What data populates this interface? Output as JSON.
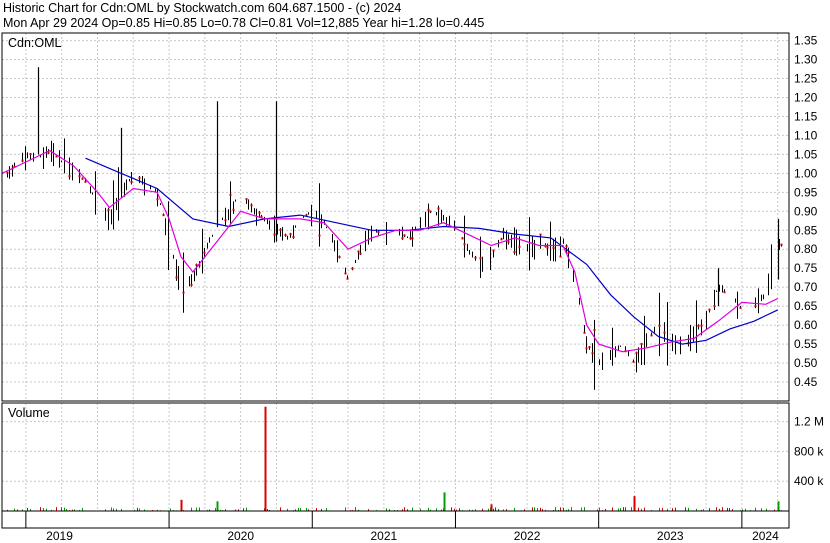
{
  "header": {
    "line1": "Historic Chart for Cdn:OML by Stockwatch.com 604.687.1500 - (c) 2024",
    "line2": "Mon Apr 29 2024  Op=0.85  Hi=0.85  Lo=0.78  Cl=0.81  Vol=12,885  Year hi=1.28  lo=0.445"
  },
  "colors": {
    "background": "#ffffff",
    "grid": "#c8c8c8",
    "price_bars": "#000000",
    "close_marks": "#cc0000",
    "ma_short": "#e000e0",
    "ma_long": "#0000cc",
    "volume_up": "#00a000",
    "volume_down": "#dd0000"
  },
  "chart_data": [
    {
      "type": "line",
      "symbol_label": "Cdn:OML",
      "xlabel": "",
      "ylabel": "",
      "x_ticks": [
        "2019",
        "2020",
        "2021",
        "2022",
        "2023",
        "2024"
      ],
      "x_range": [
        "2018-11",
        "2024-04-29"
      ],
      "ylim": [
        0.4,
        1.37
      ],
      "y_ticks": [
        0.45,
        0.5,
        0.55,
        0.6,
        0.65,
        0.7,
        0.75,
        0.8,
        0.85,
        0.9,
        0.95,
        1.0,
        1.05,
        1.1,
        1.15,
        1.2,
        1.25,
        1.3,
        1.35
      ],
      "grid": true,
      "price_path": [
        {
          "x": "2018-11",
          "y": 0.98
        },
        {
          "x": "2018-12",
          "y": 1.02
        },
        {
          "x": "2019-01",
          "y": 1.05
        },
        {
          "x": "2019-02",
          "y": 1.04
        },
        {
          "x": "2019-03",
          "y": 1.06
        },
        {
          "x": "2019-04",
          "y": 1.03
        },
        {
          "x": "2019-05",
          "y": 1.0
        },
        {
          "x": "2019-06",
          "y": 0.98
        },
        {
          "x": "2019-07",
          "y": 0.92
        },
        {
          "x": "2019-08",
          "y": 0.88
        },
        {
          "x": "2019-09",
          "y": 0.95
        },
        {
          "x": "2019-10",
          "y": 1.0
        },
        {
          "x": "2019-11",
          "y": 0.97
        },
        {
          "x": "2019-12",
          "y": 0.95
        },
        {
          "x": "2020-01",
          "y": 0.82
        },
        {
          "x": "2020-02",
          "y": 0.7
        },
        {
          "x": "2020-03",
          "y": 0.72
        },
        {
          "x": "2020-04",
          "y": 0.8
        },
        {
          "x": "2020-05",
          "y": 0.86
        },
        {
          "x": "2020-06",
          "y": 0.9
        },
        {
          "x": "2020-07",
          "y": 0.95
        },
        {
          "x": "2020-08",
          "y": 0.9
        },
        {
          "x": "2020-09",
          "y": 0.88
        },
        {
          "x": "2020-10",
          "y": 0.85
        },
        {
          "x": "2020-11",
          "y": 0.83
        },
        {
          "x": "2020-12",
          "y": 0.88
        },
        {
          "x": "2021-01",
          "y": 0.9
        },
        {
          "x": "2021-02",
          "y": 0.87
        },
        {
          "x": "2021-03",
          "y": 0.8
        },
        {
          "x": "2021-04",
          "y": 0.72
        },
        {
          "x": "2021-05",
          "y": 0.8
        },
        {
          "x": "2021-06",
          "y": 0.85
        },
        {
          "x": "2021-07",
          "y": 0.84
        },
        {
          "x": "2021-08",
          "y": 0.85
        },
        {
          "x": "2021-09",
          "y": 0.83
        },
        {
          "x": "2021-10",
          "y": 0.87
        },
        {
          "x": "2021-11",
          "y": 0.9
        },
        {
          "x": "2021-12",
          "y": 0.88
        },
        {
          "x": "2022-01",
          "y": 0.86
        },
        {
          "x": "2022-02",
          "y": 0.8
        },
        {
          "x": "2022-03",
          "y": 0.76
        },
        {
          "x": "2022-04",
          "y": 0.78
        },
        {
          "x": "2022-05",
          "y": 0.84
        },
        {
          "x": "2022-06",
          "y": 0.82
        },
        {
          "x": "2022-07",
          "y": 0.8
        },
        {
          "x": "2022-08",
          "y": 0.82
        },
        {
          "x": "2022-09",
          "y": 0.8
        },
        {
          "x": "2022-10",
          "y": 0.82
        },
        {
          "x": "2022-11",
          "y": 0.72
        },
        {
          "x": "2022-12",
          "y": 0.55
        },
        {
          "x": "2023-01",
          "y": 0.5
        },
        {
          "x": "2023-02",
          "y": 0.52
        },
        {
          "x": "2023-03",
          "y": 0.55
        },
        {
          "x": "2023-04",
          "y": 0.5
        },
        {
          "x": "2023-05",
          "y": 0.56
        },
        {
          "x": "2023-06",
          "y": 0.6
        },
        {
          "x": "2023-07",
          "y": 0.56
        },
        {
          "x": "2023-08",
          "y": 0.55
        },
        {
          "x": "2023-09",
          "y": 0.58
        },
        {
          "x": "2023-10",
          "y": 0.62
        },
        {
          "x": "2023-11",
          "y": 0.7
        },
        {
          "x": "2023-12",
          "y": 0.68
        },
        {
          "x": "2024-01",
          "y": 0.64
        },
        {
          "x": "2024-02",
          "y": 0.66
        },
        {
          "x": "2024-03",
          "y": 0.68
        },
        {
          "x": "2024-04",
          "y": 0.81
        }
      ],
      "spikes": [
        {
          "x": "2019-02",
          "high": 1.28,
          "low": 1.05
        },
        {
          "x": "2019-09",
          "high": 1.12,
          "low": 0.95
        },
        {
          "x": "2020-05",
          "high": 1.19,
          "low": 0.86
        },
        {
          "x": "2020-10",
          "high": 1.19,
          "low": 0.82
        },
        {
          "x": "2023-11",
          "high": 0.75,
          "low": 0.65
        },
        {
          "x": "2024-04",
          "high": 0.88,
          "low": 0.72
        }
      ],
      "ma_short_path": [
        {
          "x": "2018-11",
          "y": 1.0
        },
        {
          "x": "2019-01",
          "y": 1.03
        },
        {
          "x": "2019-03",
          "y": 1.06
        },
        {
          "x": "2019-05",
          "y": 1.02
        },
        {
          "x": "2019-07",
          "y": 0.95
        },
        {
          "x": "2019-08",
          "y": 0.91
        },
        {
          "x": "2019-10",
          "y": 0.96
        },
        {
          "x": "2019-12",
          "y": 0.95
        },
        {
          "x": "2020-01",
          "y": 0.88
        },
        {
          "x": "2020-02",
          "y": 0.78
        },
        {
          "x": "2020-03",
          "y": 0.74
        },
        {
          "x": "2020-05",
          "y": 0.82
        },
        {
          "x": "2020-07",
          "y": 0.9
        },
        {
          "x": "2020-09",
          "y": 0.88
        },
        {
          "x": "2020-12",
          "y": 0.88
        },
        {
          "x": "2021-02",
          "y": 0.87
        },
        {
          "x": "2021-04",
          "y": 0.8
        },
        {
          "x": "2021-06",
          "y": 0.83
        },
        {
          "x": "2021-08",
          "y": 0.85
        },
        {
          "x": "2021-10",
          "y": 0.85
        },
        {
          "x": "2021-12",
          "y": 0.87
        },
        {
          "x": "2022-02",
          "y": 0.84
        },
        {
          "x": "2022-04",
          "y": 0.81
        },
        {
          "x": "2022-06",
          "y": 0.83
        },
        {
          "x": "2022-08",
          "y": 0.81
        },
        {
          "x": "2022-10",
          "y": 0.81
        },
        {
          "x": "2022-11",
          "y": 0.74
        },
        {
          "x": "2022-12",
          "y": 0.6
        },
        {
          "x": "2023-01",
          "y": 0.55
        },
        {
          "x": "2023-03",
          "y": 0.53
        },
        {
          "x": "2023-05",
          "y": 0.54
        },
        {
          "x": "2023-07",
          "y": 0.555
        },
        {
          "x": "2023-09",
          "y": 0.565
        },
        {
          "x": "2023-11",
          "y": 0.61
        },
        {
          "x": "2024-01",
          "y": 0.66
        },
        {
          "x": "2024-03",
          "y": 0.655
        },
        {
          "x": "2024-04",
          "y": 0.67
        }
      ],
      "ma_long_path": [
        {
          "x": "2019-06",
          "y": 1.04
        },
        {
          "x": "2019-09",
          "y": 1.0
        },
        {
          "x": "2019-12",
          "y": 0.96
        },
        {
          "x": "2020-03",
          "y": 0.88
        },
        {
          "x": "2020-06",
          "y": 0.86
        },
        {
          "x": "2020-09",
          "y": 0.88
        },
        {
          "x": "2020-12",
          "y": 0.89
        },
        {
          "x": "2021-03",
          "y": 0.87
        },
        {
          "x": "2021-06",
          "y": 0.85
        },
        {
          "x": "2021-09",
          "y": 0.85
        },
        {
          "x": "2021-12",
          "y": 0.86
        },
        {
          "x": "2022-03",
          "y": 0.855
        },
        {
          "x": "2022-06",
          "y": 0.84
        },
        {
          "x": "2022-09",
          "y": 0.83
        },
        {
          "x": "2022-12",
          "y": 0.76
        },
        {
          "x": "2023-02",
          "y": 0.68
        },
        {
          "x": "2023-04",
          "y": 0.62
        },
        {
          "x": "2023-06",
          "y": 0.57
        },
        {
          "x": "2023-08",
          "y": 0.55
        },
        {
          "x": "2023-10",
          "y": 0.56
        },
        {
          "x": "2023-12",
          "y": 0.59
        },
        {
          "x": "2024-02",
          "y": 0.61
        },
        {
          "x": "2024-04",
          "y": 0.64
        }
      ]
    },
    {
      "type": "bar",
      "panel_label": "Volume",
      "ylim": [
        0,
        1450000
      ],
      "y_ticks": [
        {
          "value": 400000,
          "label": "400 k"
        },
        {
          "value": 800000,
          "label": "800 k"
        },
        {
          "value": 1200000,
          "label": "1.2 M"
        }
      ],
      "notable_bars": [
        {
          "x": "2020-09",
          "value": 1400000,
          "color": "down"
        },
        {
          "x": "2020-09",
          "value": 300000,
          "color": "down"
        },
        {
          "x": "2020-02",
          "value": 150000,
          "color": "down"
        },
        {
          "x": "2020-05",
          "value": 130000,
          "color": "up"
        },
        {
          "x": "2021-12",
          "value": 250000,
          "color": "up"
        },
        {
          "x": "2022-04",
          "value": 90000,
          "color": "down"
        },
        {
          "x": "2023-04",
          "value": 200000,
          "color": "down"
        },
        {
          "x": "2024-04",
          "value": 130000,
          "color": "up"
        }
      ]
    }
  ]
}
